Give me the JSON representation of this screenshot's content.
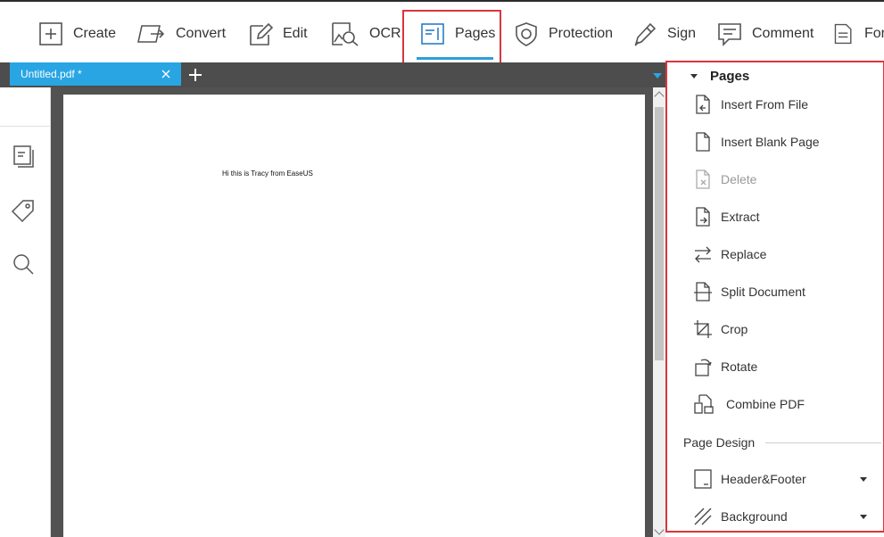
{
  "toolbar": {
    "items": [
      {
        "label": "Create",
        "icon": "plus-box-icon"
      },
      {
        "label": "Convert",
        "icon": "convert-icon"
      },
      {
        "label": "Edit",
        "icon": "edit-pen-icon"
      },
      {
        "label": "OCR",
        "icon": "ocr-icon"
      },
      {
        "label": "Pages",
        "icon": "pages-icon",
        "active": true
      },
      {
        "label": "Protection",
        "icon": "shield-icon"
      },
      {
        "label": "Sign",
        "icon": "pen-sign-icon"
      },
      {
        "label": "Comment",
        "icon": "comment-icon"
      },
      {
        "label": "For",
        "icon": "form-icon"
      }
    ]
  },
  "tabs": {
    "items": [
      {
        "title": "Untitled.pdf *"
      }
    ]
  },
  "document": {
    "text": "Hi this is Tracy from EaseUS"
  },
  "panel": {
    "title": "Pages",
    "items": [
      {
        "label": "Insert From File",
        "icon": "insert-file-icon"
      },
      {
        "label": "Insert Blank Page",
        "icon": "blank-page-icon"
      },
      {
        "label": "Delete",
        "icon": "delete-page-icon",
        "disabled": true
      },
      {
        "label": "Extract",
        "icon": "extract-icon"
      },
      {
        "label": "Replace",
        "icon": "replace-icon"
      },
      {
        "label": "Split Document",
        "icon": "split-icon"
      },
      {
        "label": "Crop",
        "icon": "crop-icon"
      },
      {
        "label": "Rotate",
        "icon": "rotate-icon"
      },
      {
        "label": "Combine PDF",
        "icon": "combine-icon"
      }
    ],
    "section": {
      "label": "Page Design",
      "items": [
        {
          "label": "Header&Footer",
          "icon": "header-footer-icon"
        },
        {
          "label": "Background",
          "icon": "background-icon"
        }
      ]
    }
  },
  "colors": {
    "accent": "#29a5e3",
    "highlight_border": "#d9363e",
    "tabbar": "#4d4d4d",
    "canvas": "#525252"
  }
}
